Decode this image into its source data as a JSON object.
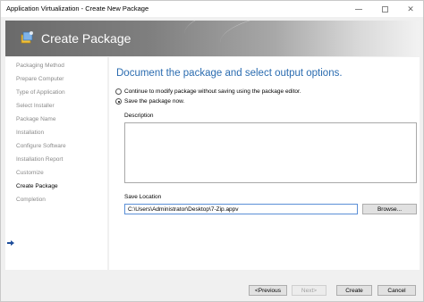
{
  "window": {
    "title": "Application Virtualization - Create New Package"
  },
  "banner": {
    "title": "Create Package",
    "icon": "package-icon"
  },
  "sidebar": {
    "items": [
      {
        "label": "Packaging Method",
        "active": false
      },
      {
        "label": "Prepare Computer",
        "active": false
      },
      {
        "label": "Type of Application",
        "active": false
      },
      {
        "label": "Select Installer",
        "active": false
      },
      {
        "label": "Package Name",
        "active": false
      },
      {
        "label": "Installation",
        "active": false
      },
      {
        "label": "Configure Software",
        "active": false
      },
      {
        "label": "Installation Report",
        "active": false
      },
      {
        "label": "Customize",
        "active": false
      },
      {
        "label": "Create Package",
        "active": true
      },
      {
        "label": "Completion",
        "active": false
      }
    ]
  },
  "main": {
    "heading": "Document the package and select output options.",
    "option_continue": "Continue to modify package without saving using the package editor.",
    "option_save": "Save the package now.",
    "description_label": "Description",
    "description_value": "",
    "save_location_label": "Save Location",
    "save_location_value": "C:\\Users\\Administrator\\Desktop\\7-Zip.appv",
    "browse_label": "Browse..."
  },
  "footer": {
    "previous_label": "<Previous",
    "next_label": "Next>",
    "create_label": "Create",
    "cancel_label": "Cancel"
  },
  "colors": {
    "heading": "#2b6cb0",
    "inactive_step": "#8a8a8a"
  }
}
